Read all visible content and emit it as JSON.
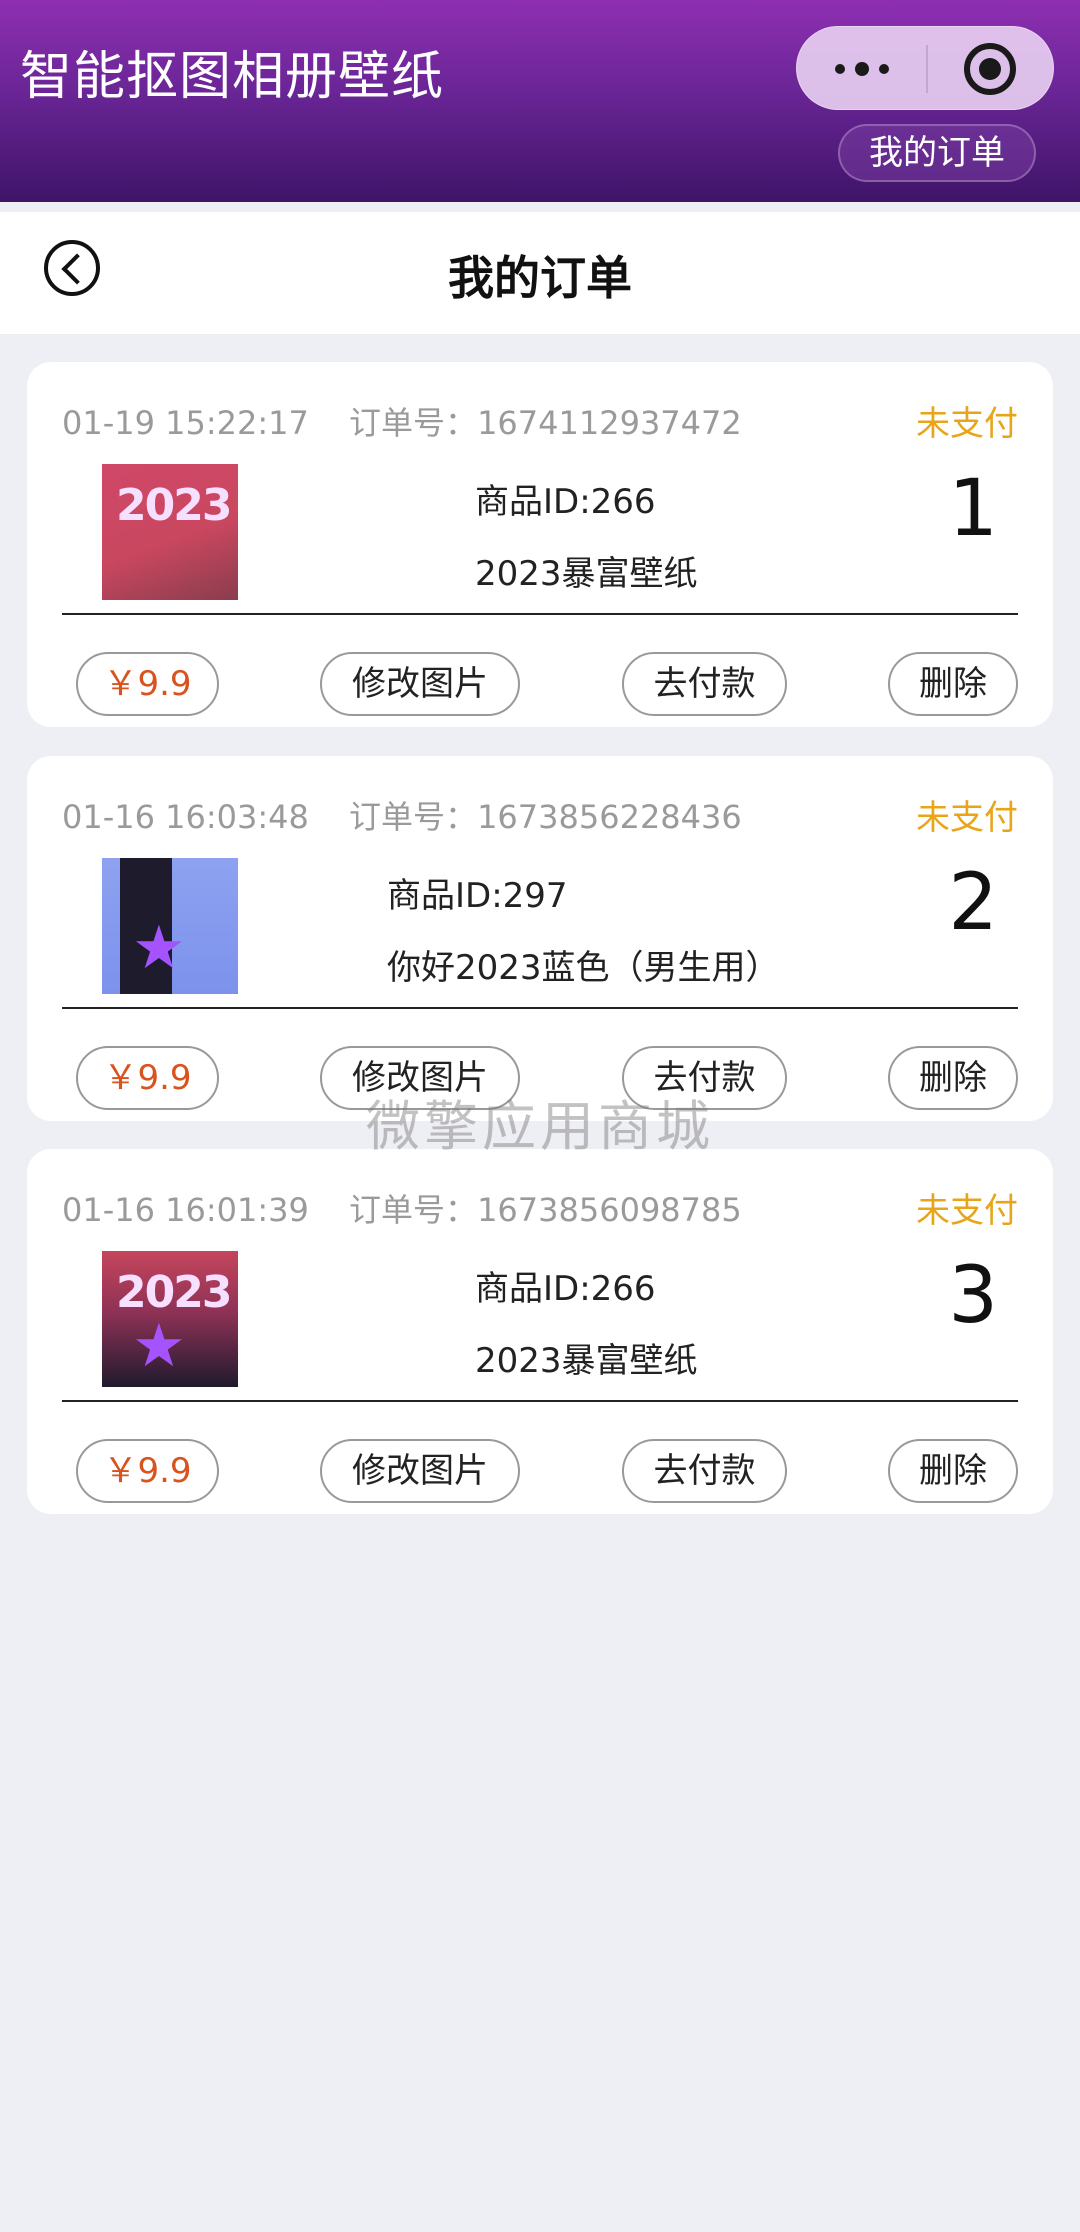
{
  "app": {
    "title": "智能抠图相册壁纸",
    "capsule_more": "more-options",
    "capsule_close": "close-miniprogram",
    "orders_pill": "我的订单"
  },
  "page": {
    "title": "我的订单"
  },
  "orders": [
    {
      "datetime": "01-19 15:22:17",
      "order_label": "订单号：",
      "order_no": "1674112937472",
      "status": "未支付",
      "product_id": "商品ID:266",
      "product_name": "2023暴富壁纸",
      "quantity": "1",
      "price": "￥9.9",
      "edit_label": "修改图片",
      "pay_label": "去付款",
      "delete_label": "删除"
    },
    {
      "datetime": "01-16 16:03:48",
      "order_label": "订单号：",
      "order_no": "1673856228436",
      "status": "未支付",
      "product_id": "商品ID:297",
      "product_name": "你好2023蓝色（男生用）",
      "quantity": "2",
      "price": "￥9.9",
      "edit_label": "修改图片",
      "pay_label": "去付款",
      "delete_label": "删除"
    },
    {
      "datetime": "01-16 16:01:39",
      "order_label": "订单号：",
      "order_no": "1673856098785",
      "status": "未支付",
      "product_id": "商品ID:266",
      "product_name": "2023暴富壁纸",
      "quantity": "3",
      "price": "￥9.9",
      "edit_label": "修改图片",
      "pay_label": "去付款",
      "delete_label": "删除"
    }
  ],
  "thumbs": {
    "year_text": "2023"
  },
  "watermark": "微擎应用商城",
  "colors": {
    "status": "#e8a51a",
    "price": "#d9531e",
    "header_top": "#8e2fb2",
    "header_bottom": "#3f1468"
  }
}
